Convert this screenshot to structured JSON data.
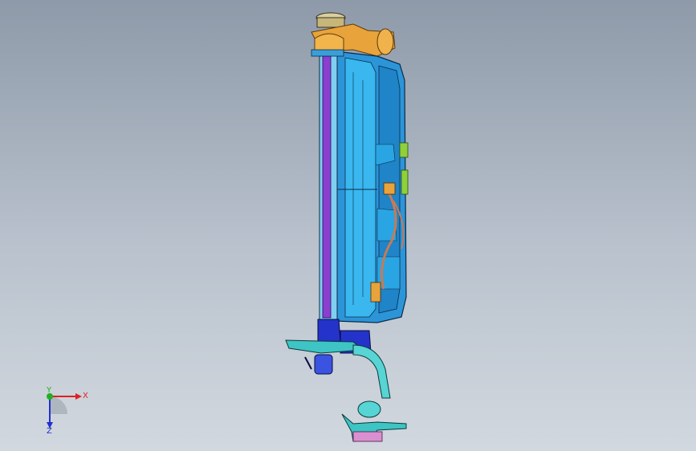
{
  "viewport": {
    "background_top": "#8e9aa9",
    "background_bottom": "#d2d8df"
  },
  "model": {
    "colors": {
      "radiator_core": "#8a3fd0",
      "fan_shroud": "#2c95d8",
      "fan_shroud_highlight": "#39b7ee",
      "hoses": "#e8a33a",
      "lower_tank": "#2433c9",
      "brackets": "#3ec4c4",
      "wiring": "#c77a55",
      "connectors": "#8fd13a"
    }
  },
  "triad": {
    "x_label": "X",
    "y_label": "Y",
    "z_label": "Z",
    "x_color": "#e02020",
    "y_color": "#20b020",
    "z_color": "#2030d0"
  }
}
